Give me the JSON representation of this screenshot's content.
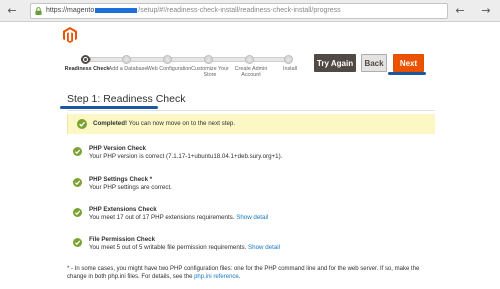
{
  "browser": {
    "url_prefix": "https://magento",
    "url_suffix": "/setup/#!/readiness-check-install/readiness-check-install/progress"
  },
  "progress": {
    "steps": [
      {
        "label": "Readiness Check",
        "active": true
      },
      {
        "label": "Add a Database",
        "active": false,
        "number": "2"
      },
      {
        "label": "Web Configuration",
        "active": false,
        "number": "3"
      },
      {
        "label": "Customize Your Store",
        "active": false,
        "number": "4"
      },
      {
        "label": "Create Admin Account",
        "active": false,
        "number": "5"
      },
      {
        "label": "Install",
        "active": false,
        "number": "6"
      }
    ]
  },
  "actions": {
    "try_again": "Try Again",
    "back": "Back",
    "next": "Next"
  },
  "page": {
    "title": "Step 1: Readiness Check"
  },
  "banner": {
    "strong": "Completed!",
    "text": " You can now move on to the next step."
  },
  "checks": [
    {
      "title": "PHP Version Check",
      "desc": "Your PHP version is correct (7.1.17-1+ubuntu18.04.1+deb.sury.org+1).",
      "link": ""
    },
    {
      "title": "PHP Settings Check *",
      "desc": "Your PHP settings are correct.",
      "link": ""
    },
    {
      "title": "PHP Extensions Check",
      "desc": "You meet 17 out of 17 PHP extensions requirements. ",
      "link": "Show detail"
    },
    {
      "title": "File Permission Check",
      "desc": "You meet 5 out of 5 writable file permission requirements. ",
      "link": "Show detail"
    }
  ],
  "footnote": {
    "text": "* - In some cases, you might have two PHP configuration files: one for the PHP command line and for the web server. If so, make the change in both php.ini files. For details, see the ",
    "link": "php.ini reference",
    "end": "."
  },
  "colors": {
    "accent_orange": "#eb5202",
    "dark_button": "#514943",
    "success_green": "#79a22e",
    "link_blue": "#1979c3",
    "annotation_blue": "#1b57a3",
    "banner_yellow": "#fbf8c6"
  },
  "icons": {
    "back": "arrow-left-icon",
    "forward": "arrow-right-icon",
    "lock": "lock-icon",
    "success": "checkmark-circle-icon",
    "logo": "magento-logo-icon"
  }
}
